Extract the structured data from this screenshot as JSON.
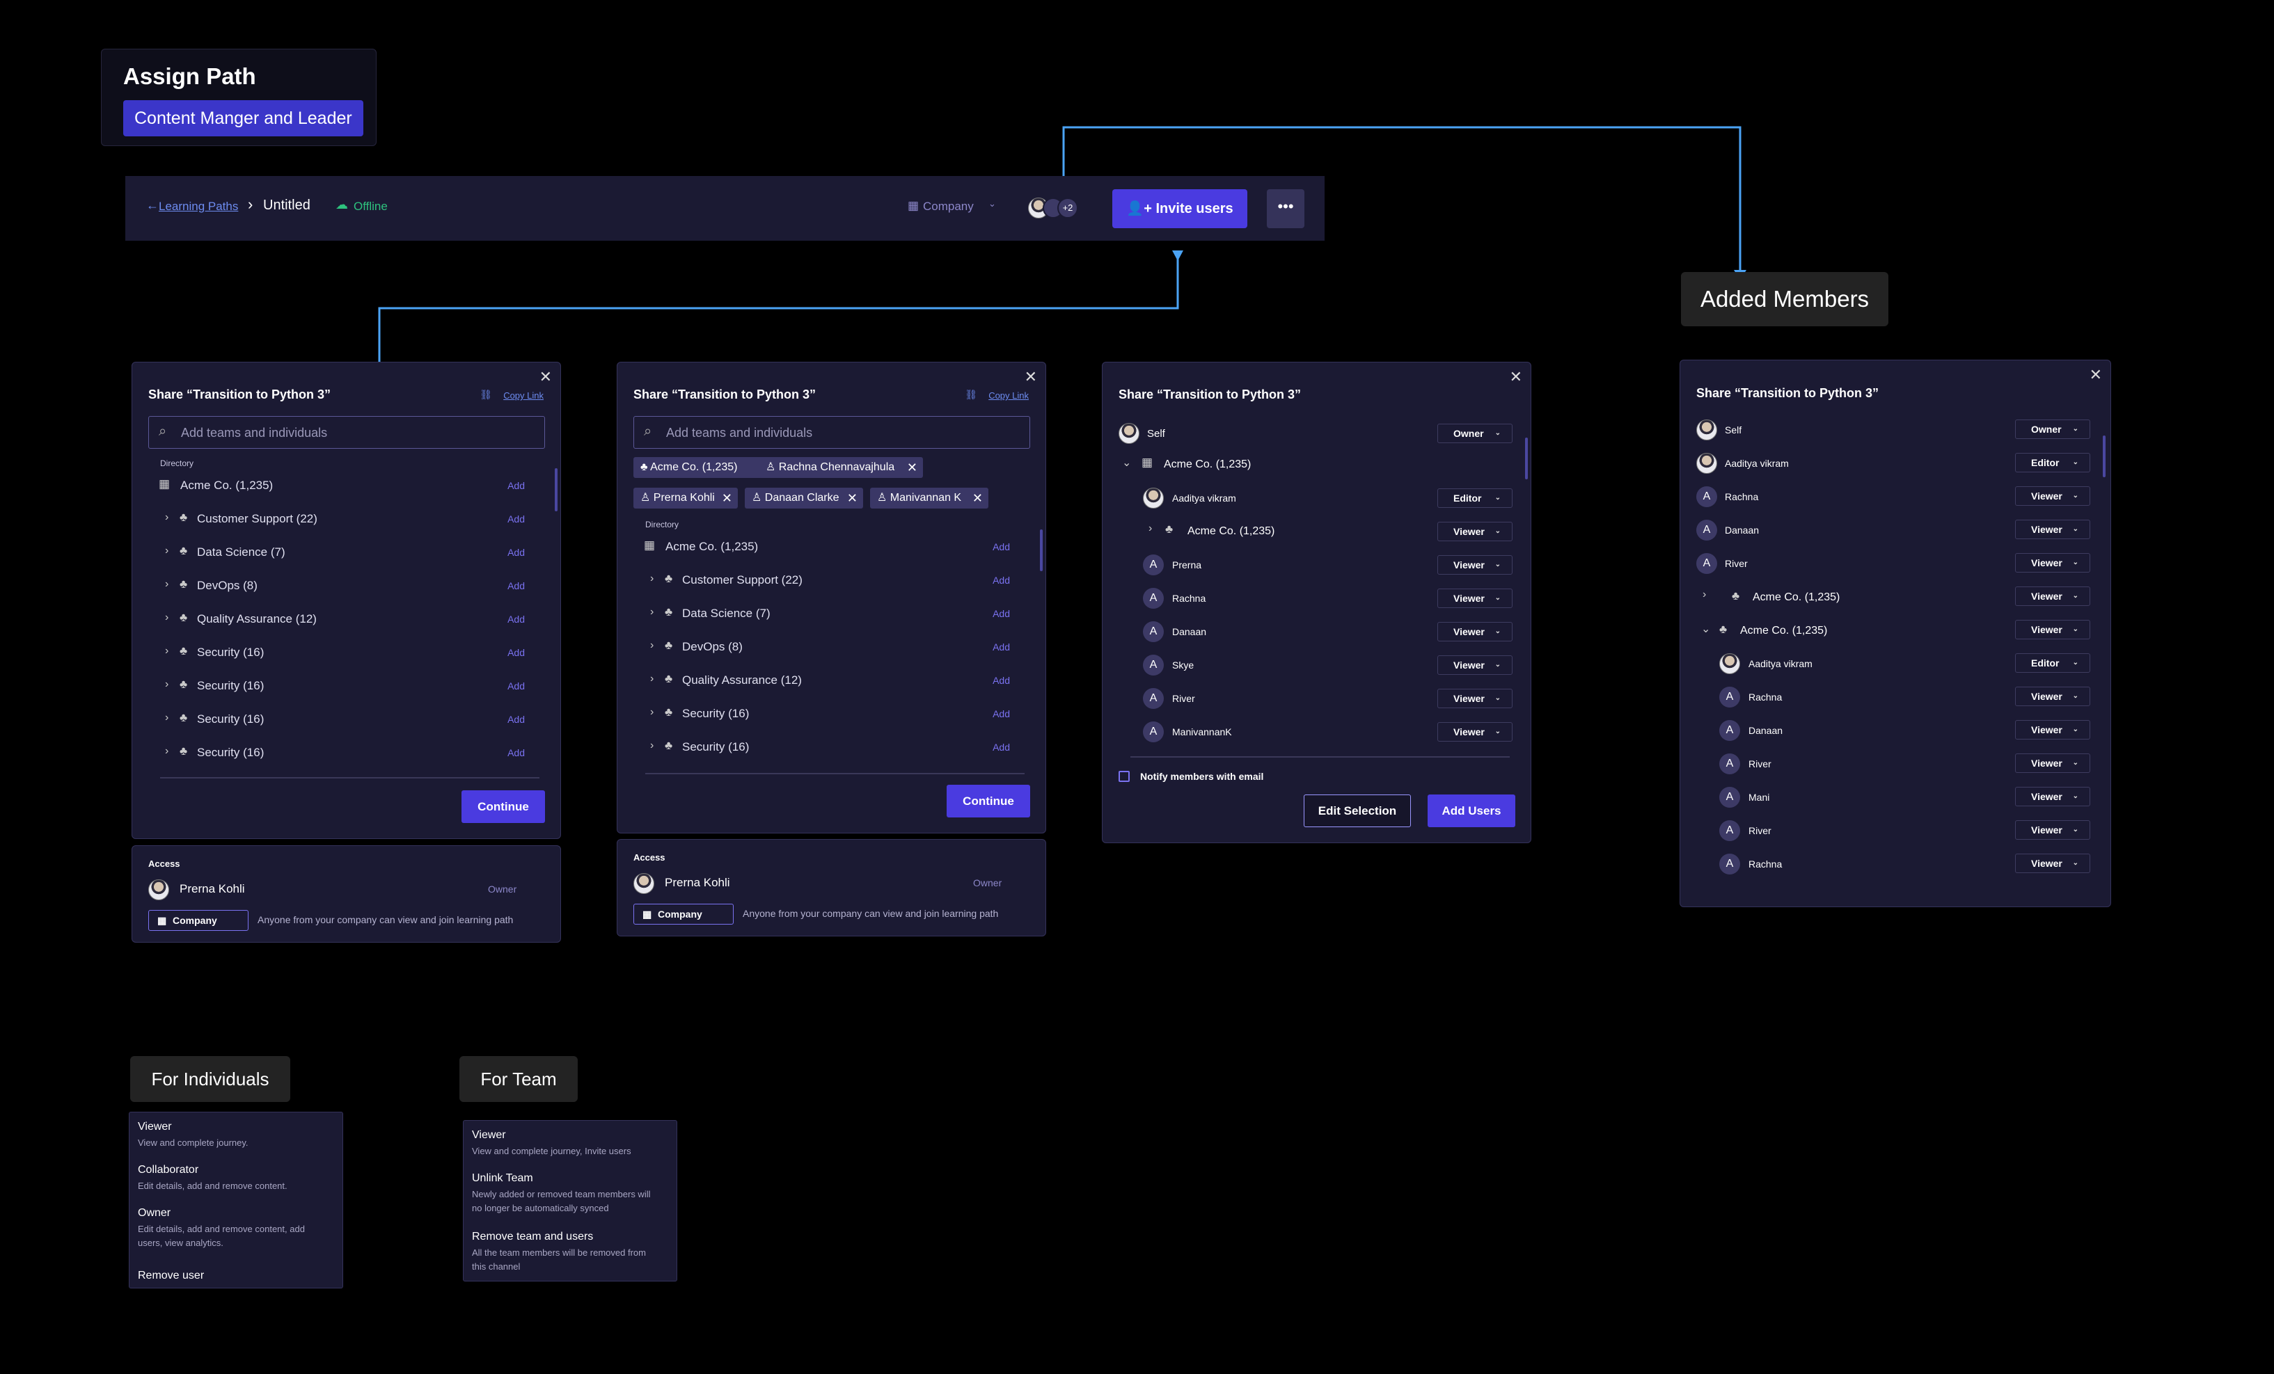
{
  "assign": {
    "title": "Assign Path",
    "path": "Content Manger and Leader"
  },
  "topbar": {
    "back_link": "Learning Paths",
    "title": "Untitled",
    "status": "Offline",
    "company": "Company",
    "avatar_count": "+2",
    "invite": "Invite users",
    "more": "•••"
  },
  "labels": {
    "added": "Added Members",
    "individuals": "For Individuals",
    "team": "For Team"
  },
  "share": {
    "title": "Share “Transition to Python 3”",
    "copy": "Copy Link",
    "placeholder": "Add teams and individuals",
    "directory": "Directory",
    "root": "Acme Co. (1,235)",
    "add": "Add",
    "continue": "Continue",
    "teams": [
      "Customer Support (22)",
      "Data Science (7)",
      "DevOps (8)",
      "Quality Assurance (12)",
      "Security (16)",
      "Security (16)",
      "Security (16)",
      "Security (16)"
    ],
    "chips": [
      "Acme Co. (1,235)",
      "Rachna Chennavajhula",
      "Prerna Kohli",
      "Danaan Clarke",
      "Manivannan K"
    ]
  },
  "access": {
    "label": "Access",
    "user": "Prerna Kohli",
    "role": "Owner",
    "company": "Company",
    "desc": "Anyone from your company can view and join learning path"
  },
  "panel3": {
    "title": "Share “Transition to Python 3”",
    "self": "Self",
    "self_role": "Owner",
    "group": "Acme Co. (1,235)",
    "members": [
      {
        "n": "Aaditya vikram",
        "r": "Editor",
        "photo": true
      },
      {
        "n": "Acme Co. (1,235)",
        "r": "Viewer",
        "group": true
      },
      {
        "n": "Prerna",
        "r": "Viewer"
      },
      {
        "n": "Rachna",
        "r": "Viewer"
      },
      {
        "n": "Danaan",
        "r": "Viewer"
      },
      {
        "n": "Skye",
        "r": "Viewer"
      },
      {
        "n": "River",
        "r": "Viewer"
      },
      {
        "n": "ManivannanK",
        "r": "Viewer"
      }
    ],
    "notify": "Notify members with email",
    "edit": "Edit Selection",
    "add": "Add Users"
  },
  "panel4": {
    "title": "Share “Transition to Python 3”",
    "top": [
      {
        "n": "Self",
        "r": "Owner",
        "photo": true
      },
      {
        "n": "Aaditya vikram",
        "r": "Editor",
        "photo": true
      },
      {
        "n": "Rachna",
        "r": "Viewer"
      },
      {
        "n": "Danaan",
        "r": "Viewer"
      },
      {
        "n": "River",
        "r": "Viewer"
      }
    ],
    "groups": [
      {
        "n": "Acme Co. (1,235)",
        "r": "Viewer",
        "chev": "›"
      },
      {
        "n": "Acme Co. (1,235)",
        "r": "Viewer",
        "chev": "⌄"
      }
    ],
    "sub": [
      {
        "n": "Aaditya vikram",
        "r": "Editor",
        "photo": true
      },
      {
        "n": "Rachna",
        "r": "Viewer"
      },
      {
        "n": "Danaan",
        "r": "Viewer"
      },
      {
        "n": "River",
        "r": "Viewer"
      },
      {
        "n": "Mani",
        "r": "Viewer"
      },
      {
        "n": "River",
        "r": "Viewer"
      },
      {
        "n": "Rachna",
        "r": "Viewer"
      }
    ]
  },
  "menu_ind": [
    {
      "t": "Viewer",
      "d": [
        "View and complete journey."
      ]
    },
    {
      "t": "Collaborator",
      "d": [
        "Edit details, add and remove content."
      ]
    },
    {
      "t": "Owner",
      "d": [
        "Edit details, add and remove content, add",
        "users, view analytics."
      ]
    },
    {
      "t": "Remove user",
      "d": []
    }
  ],
  "menu_team": [
    {
      "t": "Viewer",
      "d": [
        "View and complete journey, Invite users"
      ]
    },
    {
      "t": "Unlink Team",
      "d": [
        "Newly added or removed team members will",
        "no longer be automatically synced"
      ]
    },
    {
      "t": "Remove team and users",
      "d": [
        "All the team members will be removed from",
        "this channel"
      ]
    }
  ]
}
